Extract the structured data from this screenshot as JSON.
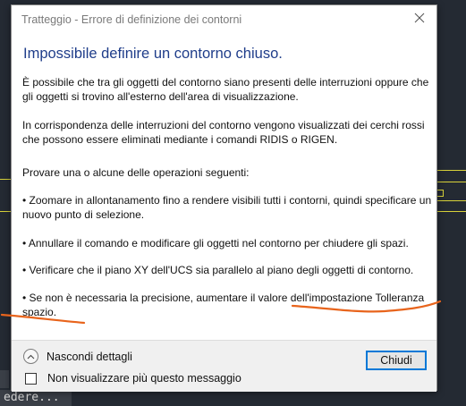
{
  "dialog": {
    "title": "Tratteggio - Errore di definizione dei contorni",
    "heading": "Impossibile definire un contorno chiuso.",
    "paragraphs": [
      "È possibile che tra gli oggetti del contorno siano presenti delle interruzioni oppure che gli oggetti si trovino all'esterno dell'area di visualizzazione.",
      "In corrispondenza delle interruzioni del contorno vengono visualizzati dei cerchi rossi che possono essere eliminati mediante i comandi  RIDIS o RIGEN.",
      "Provare una o alcune delle operazioni seguenti:",
      "•  Zoomare in allontanamento fino a rendere visibili tutti i contorni, quindi specificare un nuovo punto di selezione.",
      "•  Annullare il comando e modificare gli oggetti nel contorno per chiudere gli spazi.",
      "•  Verificare che il piano XY dell'UCS sia parallelo al piano degli oggetti di contorno.",
      "•  Se non è necessaria la precisione, aumentare il valore dell'impostazione Tolleranza spazio."
    ],
    "footer": {
      "details_label": "Nascondi dettagli",
      "checkbox_label": "Non visualizzare più questo messaggio",
      "checkbox_checked": false,
      "close_label": "Chiudi"
    },
    "icons": {
      "close": "close-icon",
      "details": "chevron-up-icon"
    }
  },
  "background": {
    "command_line_text": "edere..."
  },
  "colors": {
    "heading": "#1f3d8a",
    "annotation": "#e8641c",
    "cad_lines": "#d8d23a",
    "button_focus": "#0078d7"
  }
}
